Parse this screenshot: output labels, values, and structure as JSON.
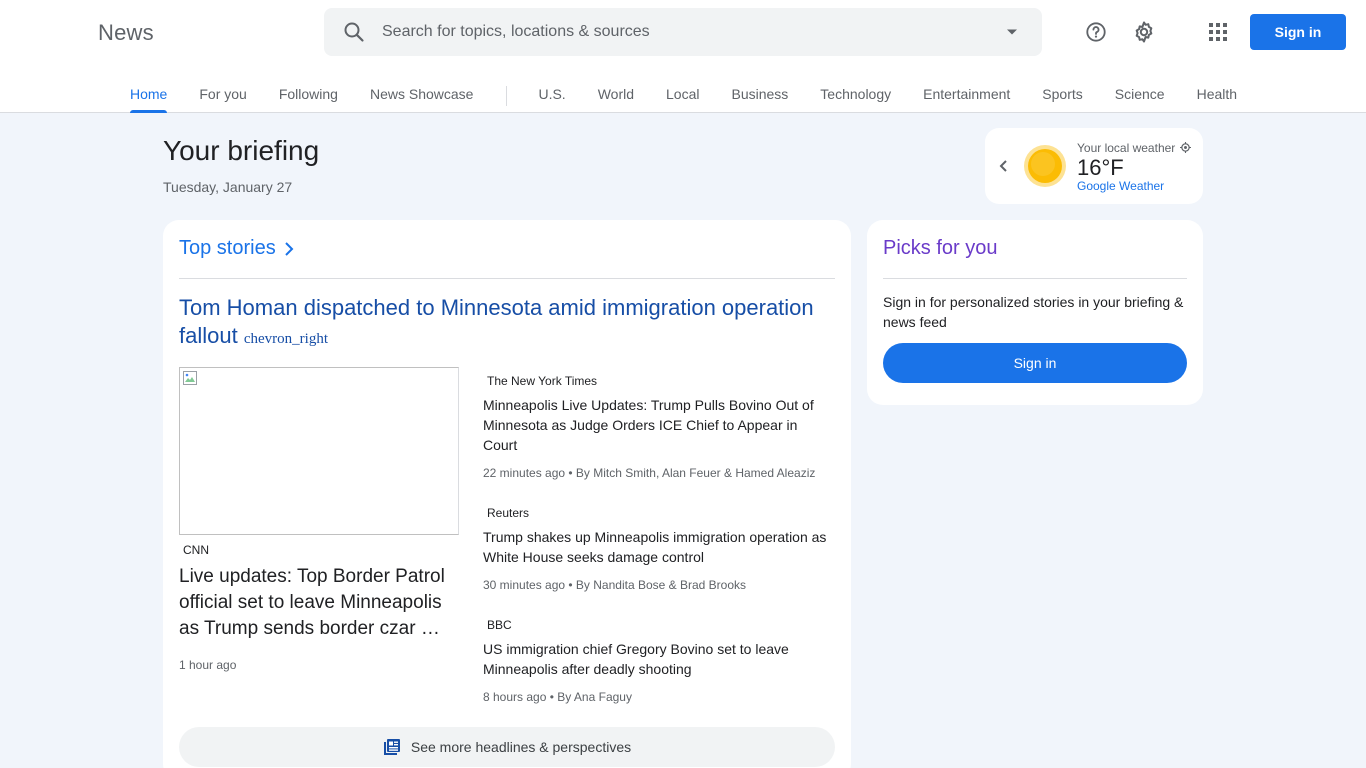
{
  "header": {
    "logo": "News",
    "search_placeholder": "Search for topics, locations & sources",
    "signin_label": "Sign in"
  },
  "nav": {
    "primary": [
      "Home",
      "For you",
      "Following",
      "News Showcase"
    ],
    "sections": [
      "U.S.",
      "World",
      "Local",
      "Business",
      "Technology",
      "Entertainment",
      "Sports",
      "Science",
      "Health"
    ],
    "active": "Home"
  },
  "briefing": {
    "title": "Your briefing",
    "date": "Tuesday, January 27"
  },
  "weather": {
    "label": "Your local weather",
    "temp": "16°F",
    "link": "Google Weather"
  },
  "top_stories": {
    "heading": "Top stories",
    "cluster_headline": "Tom Homan dispatched to Minnesota amid immigration operation fallout",
    "cluster_chevron_text": "chevron_right",
    "main": {
      "source": "CNN",
      "title": "Live updates: Top Border Patrol official set to leave Minneapolis as Trump sends border czar …",
      "time": "1 hour ago"
    },
    "articles": [
      {
        "source": "The New York Times",
        "title": "Minneapolis Live Updates: Trump Pulls Bovino Out of Minnesota as Judge Orders ICE Chief to Appear in Court",
        "meta": "22 minutes ago • By Mitch Smith, Alan Feuer & Hamed Aleaziz"
      },
      {
        "source": "Reuters",
        "title": "Trump shakes up Minneapolis immigration operation as White House seeks damage control",
        "meta": "30 minutes ago • By Nandita Bose & Brad Brooks"
      },
      {
        "source": "BBC",
        "title": "US immigration chief Gregory Bovino set to leave Minneapolis after deadly shooting",
        "meta": "8 hours ago • By Ana Faguy"
      }
    ],
    "more_label": "See more headlines & perspectives"
  },
  "picks": {
    "title": "Picks for you",
    "text": "Sign in for personalized stories in your briefing & news feed",
    "button": "Sign in"
  },
  "colors": {
    "accent": "#1a73e8",
    "headline": "#174ea6",
    "picks_title": "#6a3bc9",
    "background": "#f1f5fb"
  }
}
